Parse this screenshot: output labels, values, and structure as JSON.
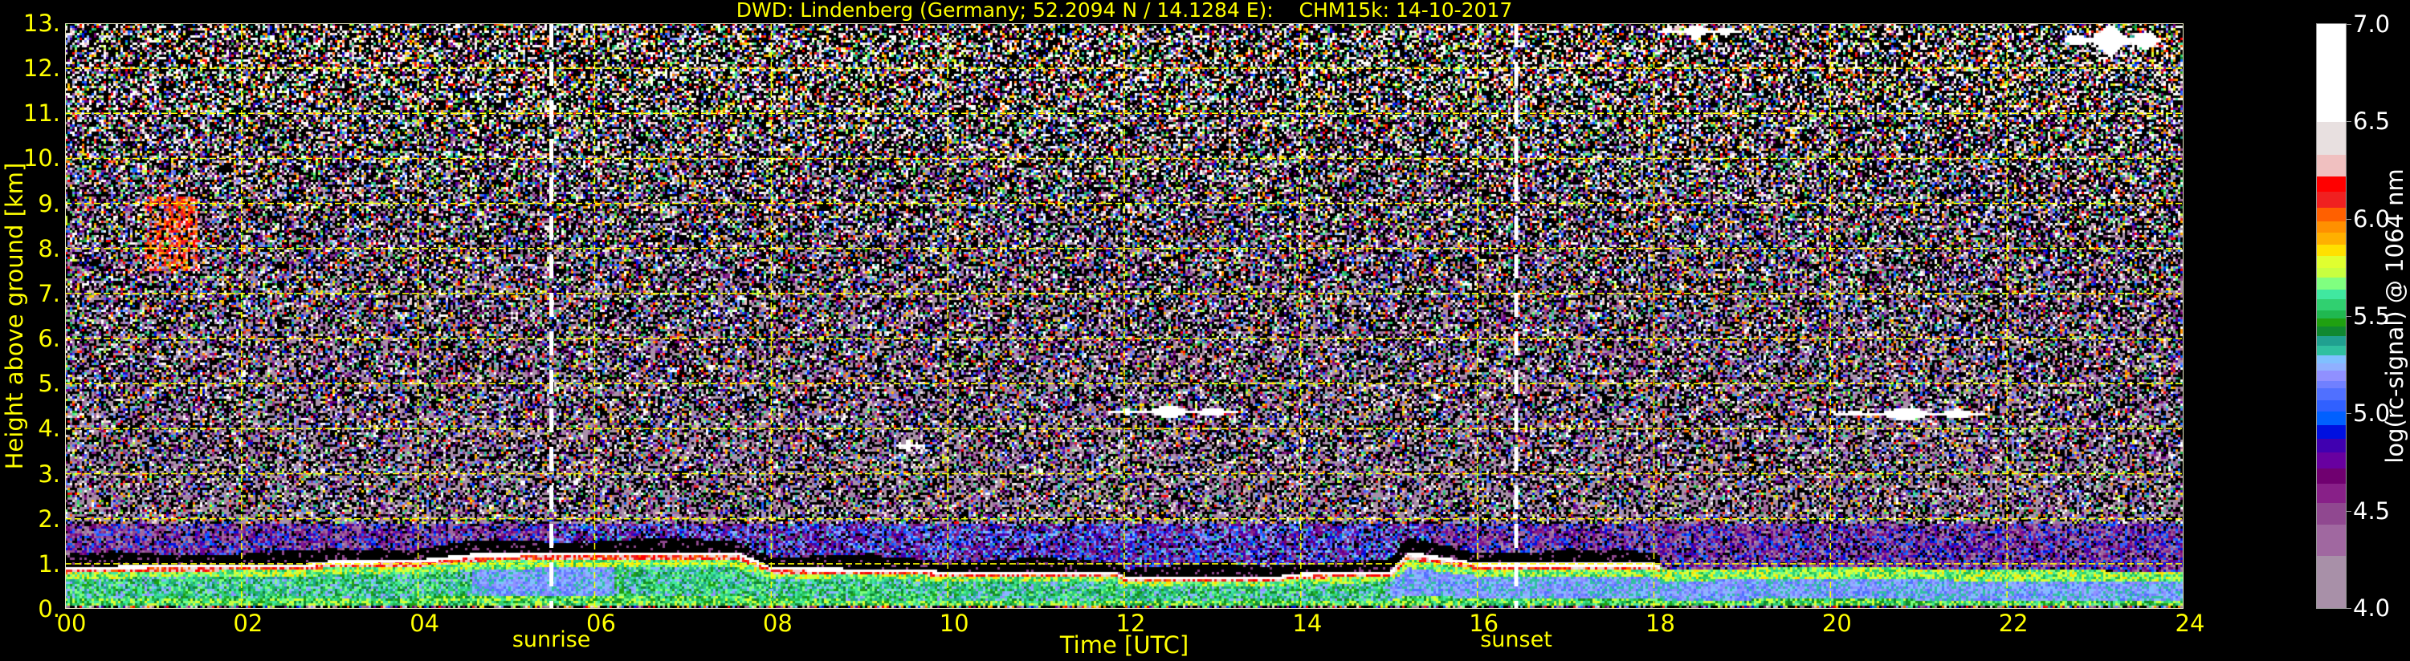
{
  "chart_data": {
    "type": "heatmap",
    "title": "DWD: Lindenberg (Germany; 52.2094 N / 14.1284 E):    CHM15k: 14-10-2017",
    "xlabel": "Time [UTC]",
    "ylabel": "Height above ground [km]",
    "xlim": [
      0,
      24
    ],
    "ylim": [
      0,
      13
    ],
    "grid": true,
    "grid_color": "#ffff00",
    "x_ticks": [
      0,
      2,
      4,
      6,
      8,
      10,
      12,
      14,
      16,
      18,
      20,
      22,
      24
    ],
    "x_tick_labels": [
      "00",
      "02",
      "04",
      "06",
      "08",
      "10",
      "12",
      "14",
      "16",
      "18",
      "20",
      "22",
      "24"
    ],
    "y_ticks": [
      0,
      1,
      2,
      3,
      4,
      5,
      6,
      7,
      8,
      9,
      10,
      11,
      12,
      13
    ],
    "y_tick_labels": [
      "0.",
      "1.",
      "2.",
      "3.",
      "4.",
      "5.",
      "6.",
      "7.",
      "8.",
      "9.",
      "10.",
      "11.",
      "12.",
      "13."
    ],
    "annotations": [
      {
        "label": "sunrise",
        "x": 5.51,
        "style": "white-dashed-vline"
      },
      {
        "label": "sunset",
        "x": 16.44,
        "style": "white-dashed-vline"
      }
    ],
    "colorbar": {
      "label": "log(rc-signal) @ 1064 nm",
      "range": [
        4.0,
        7.0
      ],
      "ticks": [
        4.0,
        4.5,
        5.0,
        5.5,
        6.0,
        6.5,
        7.0
      ],
      "tick_labels": [
        "4.0",
        "4.5",
        "5.0",
        "5.5",
        "6.0",
        "6.5",
        "7.0"
      ],
      "bounds": [
        4.0,
        4.27,
        4.43,
        4.54,
        4.64,
        4.72,
        4.8,
        4.87,
        4.94,
        5.01,
        5.07,
        5.13,
        5.17,
        5.22,
        5.26,
        5.3,
        5.35,
        5.4,
        5.45,
        5.49,
        5.53,
        5.59,
        5.64,
        5.7,
        5.75,
        5.81,
        5.87,
        5.93,
        5.99,
        6.06,
        6.14,
        6.22,
        6.33,
        6.5,
        7.0
      ],
      "colors": [
        "#a890a8",
        "#a068a0",
        "#904890",
        "#882088",
        "#700070",
        "#6800a0",
        "#4000b0",
        "#0010e0",
        "#0060ff",
        "#3060ff",
        "#5070ff",
        "#7080ff",
        "#9090ff",
        "#90b0ff",
        "#80c0ff",
        "#30c0a0",
        "#20a090",
        "#108830",
        "#20a010",
        "#20b850",
        "#30d070",
        "#40e8a0",
        "#80ff80",
        "#c8ff40",
        "#e0ff30",
        "#ffe000",
        "#ffb000",
        "#ff9000",
        "#ff6000",
        "#f02020",
        "#ff0000",
        "#f0c0c0",
        "#e8e0e0",
        "#ffffff"
      ]
    },
    "boundary_layer_top_km": {
      "x": [
        0,
        1,
        2,
        2.7,
        3,
        4,
        4.6,
        5,
        6,
        7,
        7.6,
        8,
        9,
        9.6,
        10,
        11,
        11.9,
        12,
        13,
        13.6,
        14,
        15,
        15.2,
        16,
        17,
        18,
        18.1,
        20,
        22,
        24
      ],
      "y": [
        0.95,
        1.0,
        1.02,
        1.02,
        1.1,
        1.12,
        1.25,
        1.28,
        1.3,
        1.3,
        1.3,
        0.95,
        0.92,
        0.92,
        0.85,
        0.85,
        0.85,
        0.72,
        0.75,
        0.72,
        0.82,
        0.85,
        1.3,
        1.05,
        1.05,
        1.05,
        0.9,
        0.95,
        0.9,
        0.85
      ]
    },
    "cloud_features": [
      {
        "type": "cirrus",
        "x": [
          0.9,
          1.5
        ],
        "y": [
          7.5,
          9.2
        ]
      },
      {
        "type": "cloud",
        "x": [
          9.4,
          9.7
        ],
        "y": [
          3.5,
          3.8
        ]
      },
      {
        "type": "cloud",
        "x": [
          11.8,
          13.3
        ],
        "y": [
          4.25,
          4.55
        ]
      },
      {
        "type": "cloud",
        "x": [
          20.0,
          21.8
        ],
        "y": [
          4.2,
          4.5
        ]
      },
      {
        "type": "cloud",
        "x": [
          18.0,
          19.0
        ],
        "y": [
          12.7,
          13.0
        ]
      },
      {
        "type": "cloud",
        "x": [
          22.6,
          23.8
        ],
        "y": [
          12.3,
          13.0
        ]
      }
    ]
  }
}
